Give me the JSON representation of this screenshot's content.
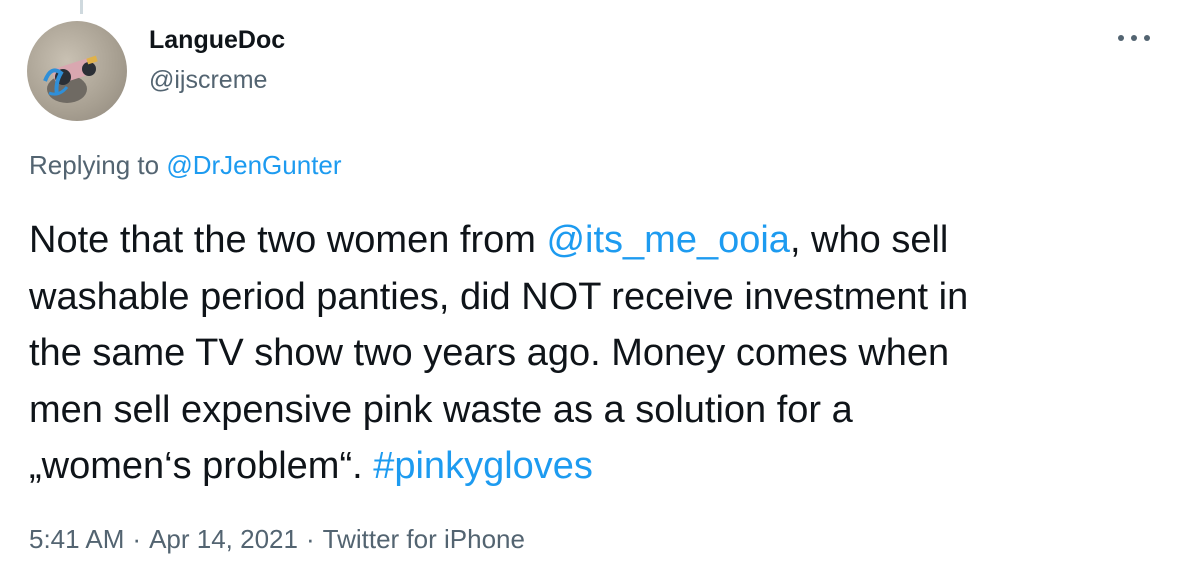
{
  "author": {
    "display_name": "LangueDoc",
    "handle": "@ijscreme",
    "avatar_icon": "avatar-photo-icon"
  },
  "reply": {
    "prefix": "Replying to ",
    "mention": "@DrJenGunter"
  },
  "tweet": {
    "line1_before": "Note that the two women from ",
    "line1_mention": "@its_me_ooia",
    "line1_after": ", who sell",
    "line2": "washable period panties, did NOT receive investment in",
    "line3": "the same TV show two years ago. Money comes when",
    "line4": "men sell expensive pink waste as a solution for a",
    "line5_before": "„women‘s problem“. ",
    "line5_hashtag": "#pinkygloves"
  },
  "meta": {
    "time": "5:41 AM",
    "separator": "·",
    "date": "Apr 14, 2021",
    "source": "Twitter for iPhone"
  },
  "colors": {
    "link": "#1d9bf0",
    "secondary_text": "#536471",
    "primary_text": "#0f1419",
    "thread_line": "#cfd9de"
  }
}
